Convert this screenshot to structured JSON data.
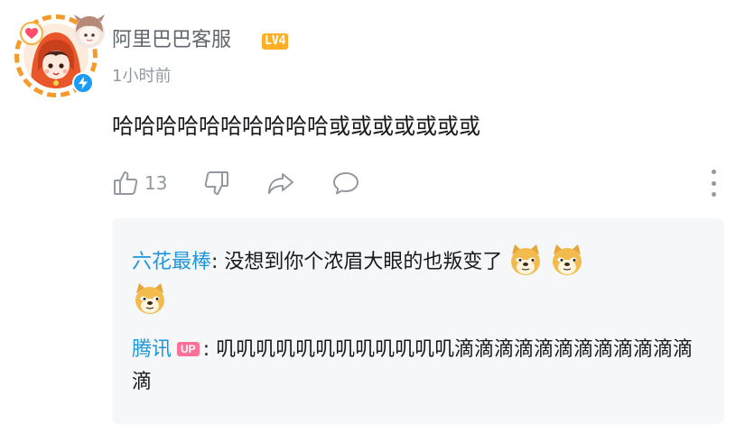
{
  "comment": {
    "username": "阿里巴巴客服",
    "level": "LV4",
    "timestamp": "1小时前",
    "content": "哈哈哈哈哈哈哈哈哈哈或或或或或或或",
    "likes": "13"
  },
  "icons": {
    "avatar": "avatar-image",
    "heart": "heart-icon",
    "verified": "lightning-verified-icon",
    "like": "thumbs-up-icon",
    "dislike": "thumbs-down-icon",
    "share": "share-icon",
    "reply": "comment-bubble-icon",
    "more": "more-vertical-icon",
    "emoji": "doge-emoji"
  },
  "replies": [
    {
      "name": "六花最棒",
      "separator": ": ",
      "text": "没想到你个浓眉大眼的也叛变了",
      "emoji_count": 3
    },
    {
      "name": "腾讯",
      "badge": "UP",
      "separator": ": ",
      "text": "叽叽叽叽叽叽叽叽叽叽叽叽滴滴滴滴滴滴滴滴滴滴滴滴滴"
    }
  ],
  "colors": {
    "username": "#61666d",
    "level_badge": "#ffb027",
    "reply_name": "#1e96d8",
    "up_badge": "#fb7299",
    "muted": "#9499a0",
    "reply_bg": "#f6f7f8",
    "avatar_ring": "#f59b2b"
  }
}
